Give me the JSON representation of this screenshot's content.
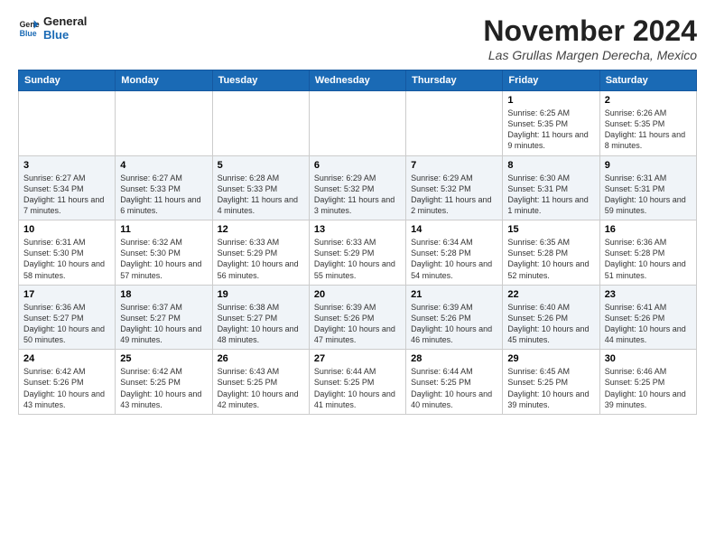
{
  "header": {
    "logo_line1": "General",
    "logo_line2": "Blue",
    "month_title": "November 2024",
    "location": "Las Grullas Margen Derecha, Mexico"
  },
  "day_headers": [
    "Sunday",
    "Monday",
    "Tuesday",
    "Wednesday",
    "Thursday",
    "Friday",
    "Saturday"
  ],
  "weeks": [
    [
      {
        "day": "",
        "info": ""
      },
      {
        "day": "",
        "info": ""
      },
      {
        "day": "",
        "info": ""
      },
      {
        "day": "",
        "info": ""
      },
      {
        "day": "",
        "info": ""
      },
      {
        "day": "1",
        "info": "Sunrise: 6:25 AM\nSunset: 5:35 PM\nDaylight: 11 hours and 9 minutes."
      },
      {
        "day": "2",
        "info": "Sunrise: 6:26 AM\nSunset: 5:35 PM\nDaylight: 11 hours and 8 minutes."
      }
    ],
    [
      {
        "day": "3",
        "info": "Sunrise: 6:27 AM\nSunset: 5:34 PM\nDaylight: 11 hours and 7 minutes."
      },
      {
        "day": "4",
        "info": "Sunrise: 6:27 AM\nSunset: 5:33 PM\nDaylight: 11 hours and 6 minutes."
      },
      {
        "day": "5",
        "info": "Sunrise: 6:28 AM\nSunset: 5:33 PM\nDaylight: 11 hours and 4 minutes."
      },
      {
        "day": "6",
        "info": "Sunrise: 6:29 AM\nSunset: 5:32 PM\nDaylight: 11 hours and 3 minutes."
      },
      {
        "day": "7",
        "info": "Sunrise: 6:29 AM\nSunset: 5:32 PM\nDaylight: 11 hours and 2 minutes."
      },
      {
        "day": "8",
        "info": "Sunrise: 6:30 AM\nSunset: 5:31 PM\nDaylight: 11 hours and 1 minute."
      },
      {
        "day": "9",
        "info": "Sunrise: 6:31 AM\nSunset: 5:31 PM\nDaylight: 10 hours and 59 minutes."
      }
    ],
    [
      {
        "day": "10",
        "info": "Sunrise: 6:31 AM\nSunset: 5:30 PM\nDaylight: 10 hours and 58 minutes."
      },
      {
        "day": "11",
        "info": "Sunrise: 6:32 AM\nSunset: 5:30 PM\nDaylight: 10 hours and 57 minutes."
      },
      {
        "day": "12",
        "info": "Sunrise: 6:33 AM\nSunset: 5:29 PM\nDaylight: 10 hours and 56 minutes."
      },
      {
        "day": "13",
        "info": "Sunrise: 6:33 AM\nSunset: 5:29 PM\nDaylight: 10 hours and 55 minutes."
      },
      {
        "day": "14",
        "info": "Sunrise: 6:34 AM\nSunset: 5:28 PM\nDaylight: 10 hours and 54 minutes."
      },
      {
        "day": "15",
        "info": "Sunrise: 6:35 AM\nSunset: 5:28 PM\nDaylight: 10 hours and 52 minutes."
      },
      {
        "day": "16",
        "info": "Sunrise: 6:36 AM\nSunset: 5:28 PM\nDaylight: 10 hours and 51 minutes."
      }
    ],
    [
      {
        "day": "17",
        "info": "Sunrise: 6:36 AM\nSunset: 5:27 PM\nDaylight: 10 hours and 50 minutes."
      },
      {
        "day": "18",
        "info": "Sunrise: 6:37 AM\nSunset: 5:27 PM\nDaylight: 10 hours and 49 minutes."
      },
      {
        "day": "19",
        "info": "Sunrise: 6:38 AM\nSunset: 5:27 PM\nDaylight: 10 hours and 48 minutes."
      },
      {
        "day": "20",
        "info": "Sunrise: 6:39 AM\nSunset: 5:26 PM\nDaylight: 10 hours and 47 minutes."
      },
      {
        "day": "21",
        "info": "Sunrise: 6:39 AM\nSunset: 5:26 PM\nDaylight: 10 hours and 46 minutes."
      },
      {
        "day": "22",
        "info": "Sunrise: 6:40 AM\nSunset: 5:26 PM\nDaylight: 10 hours and 45 minutes."
      },
      {
        "day": "23",
        "info": "Sunrise: 6:41 AM\nSunset: 5:26 PM\nDaylight: 10 hours and 44 minutes."
      }
    ],
    [
      {
        "day": "24",
        "info": "Sunrise: 6:42 AM\nSunset: 5:26 PM\nDaylight: 10 hours and 43 minutes."
      },
      {
        "day": "25",
        "info": "Sunrise: 6:42 AM\nSunset: 5:25 PM\nDaylight: 10 hours and 43 minutes."
      },
      {
        "day": "26",
        "info": "Sunrise: 6:43 AM\nSunset: 5:25 PM\nDaylight: 10 hours and 42 minutes."
      },
      {
        "day": "27",
        "info": "Sunrise: 6:44 AM\nSunset: 5:25 PM\nDaylight: 10 hours and 41 minutes."
      },
      {
        "day": "28",
        "info": "Sunrise: 6:44 AM\nSunset: 5:25 PM\nDaylight: 10 hours and 40 minutes."
      },
      {
        "day": "29",
        "info": "Sunrise: 6:45 AM\nSunset: 5:25 PM\nDaylight: 10 hours and 39 minutes."
      },
      {
        "day": "30",
        "info": "Sunrise: 6:46 AM\nSunset: 5:25 PM\nDaylight: 10 hours and 39 minutes."
      }
    ]
  ]
}
